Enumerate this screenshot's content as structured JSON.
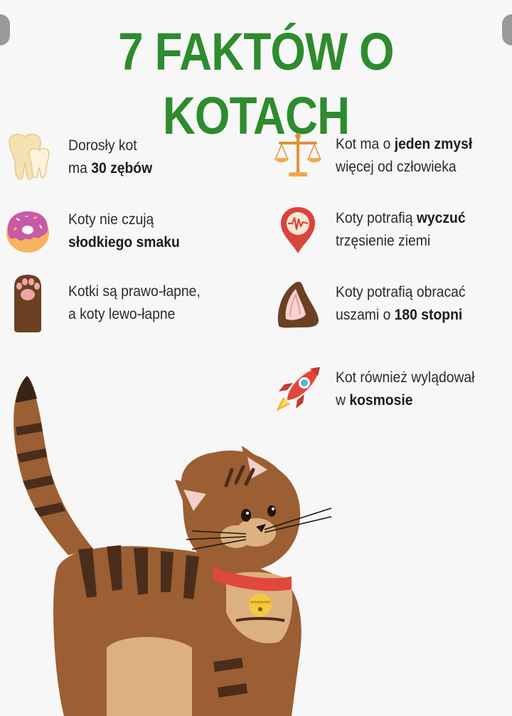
{
  "title": "7 FAKTÓW O KOTACH",
  "colors": {
    "title": "#2e8b2e",
    "background": "#f7f7f7"
  },
  "facts": [
    {
      "icon": "tooth-icon",
      "line1_pre": "Dorosły kot",
      "line1_bold": "",
      "line2_pre": "ma ",
      "line2_bold": "30 zębów",
      "line2_post": ""
    },
    {
      "icon": "scales-icon",
      "line1_pre": "Kot ma o ",
      "line1_bold": "jeden zmysł",
      "line2_pre": "więcej od człowieka",
      "line2_bold": "",
      "line2_post": ""
    },
    {
      "icon": "donut-icon",
      "line1_pre": "Koty nie czują",
      "line1_bold": "",
      "line2_pre": "",
      "line2_bold": "słodkiego smaku",
      "line2_post": ""
    },
    {
      "icon": "seismograph-pin-icon",
      "line1_pre": "Koty potrafią ",
      "line1_bold": "wyczuć",
      "line2_pre": "trzęsienie ziemi",
      "line2_bold": "",
      "line2_post": ""
    },
    {
      "icon": "paw-icon",
      "line1_pre": "Kotki są prawo-łapne,",
      "line1_bold": "",
      "line2_pre": "a koty lewo-łapne",
      "line2_bold": "",
      "line2_post": ""
    },
    {
      "icon": "cat-ear-icon",
      "line1_pre": "Koty potrafią obracać",
      "line1_bold": "",
      "line2_pre": "uszami o ",
      "line2_bold": "180 stopni",
      "line2_post": ""
    },
    {
      "icon": "rocket-icon",
      "line1_pre": "Kot również wylądował",
      "line1_bold": "",
      "line2_pre": "w ",
      "line2_bold": "kosmosie",
      "line2_post": ""
    }
  ]
}
